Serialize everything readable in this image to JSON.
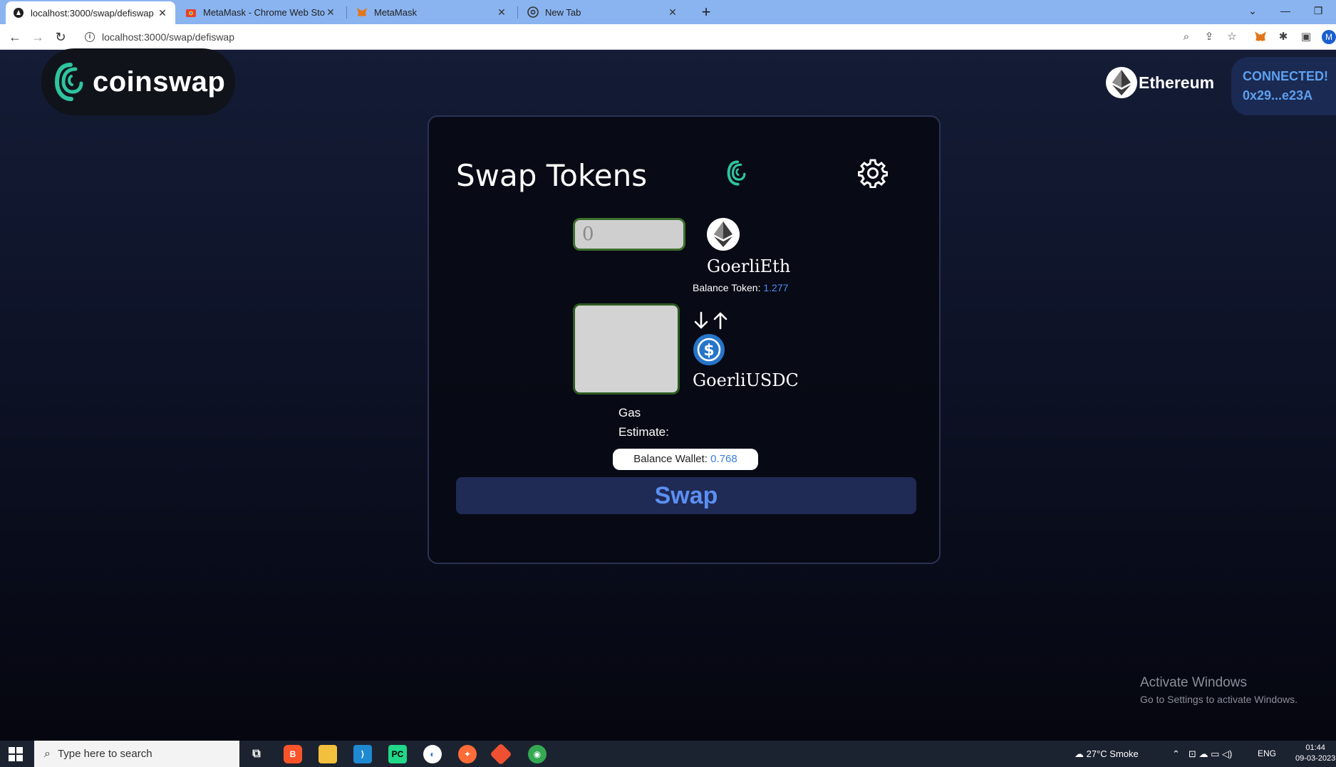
{
  "browser": {
    "tabs": [
      {
        "title": "localhost:3000/swap/defiswap",
        "close": "✕"
      },
      {
        "title": "MetaMask - Chrome Web Store",
        "close": "✕"
      },
      {
        "title": "MetaMask",
        "close": "✕"
      },
      {
        "title": "New Tab",
        "close": "✕"
      }
    ],
    "new_tab": "+",
    "url": "localhost:3000/swap/defiswap",
    "profile_initial": "M"
  },
  "header": {
    "logo_text": "coinswap",
    "network_label": "Ethereum",
    "connection_status": "CONNECTED!",
    "wallet_address": "0x29...e23A"
  },
  "swap": {
    "title": "Swap Tokens",
    "amount_placeholder": "0",
    "from_token": {
      "name": "GoerliEth",
      "balance_label": "Balance Token:",
      "balance_value": "1.277"
    },
    "to_token": {
      "name": "GoerliUSDC"
    },
    "gas_label": "Gas Estimate:",
    "wallet_balance_label": "Balance Wallet:",
    "wallet_balance_value": "0.768",
    "swap_button": "Swap"
  },
  "watermark": {
    "line1": "Activate Windows",
    "line2": "Go to Settings to activate Windows."
  },
  "taskbar": {
    "search_placeholder": "Type here to search",
    "weather": "27°C  Smoke",
    "language": "ENG",
    "time": "01:44",
    "date": "09-03-2023"
  },
  "colors": {
    "accent_green": "#2ec4a0",
    "accent_blue": "#5b8ff2",
    "usdc_blue": "#2775ca"
  }
}
